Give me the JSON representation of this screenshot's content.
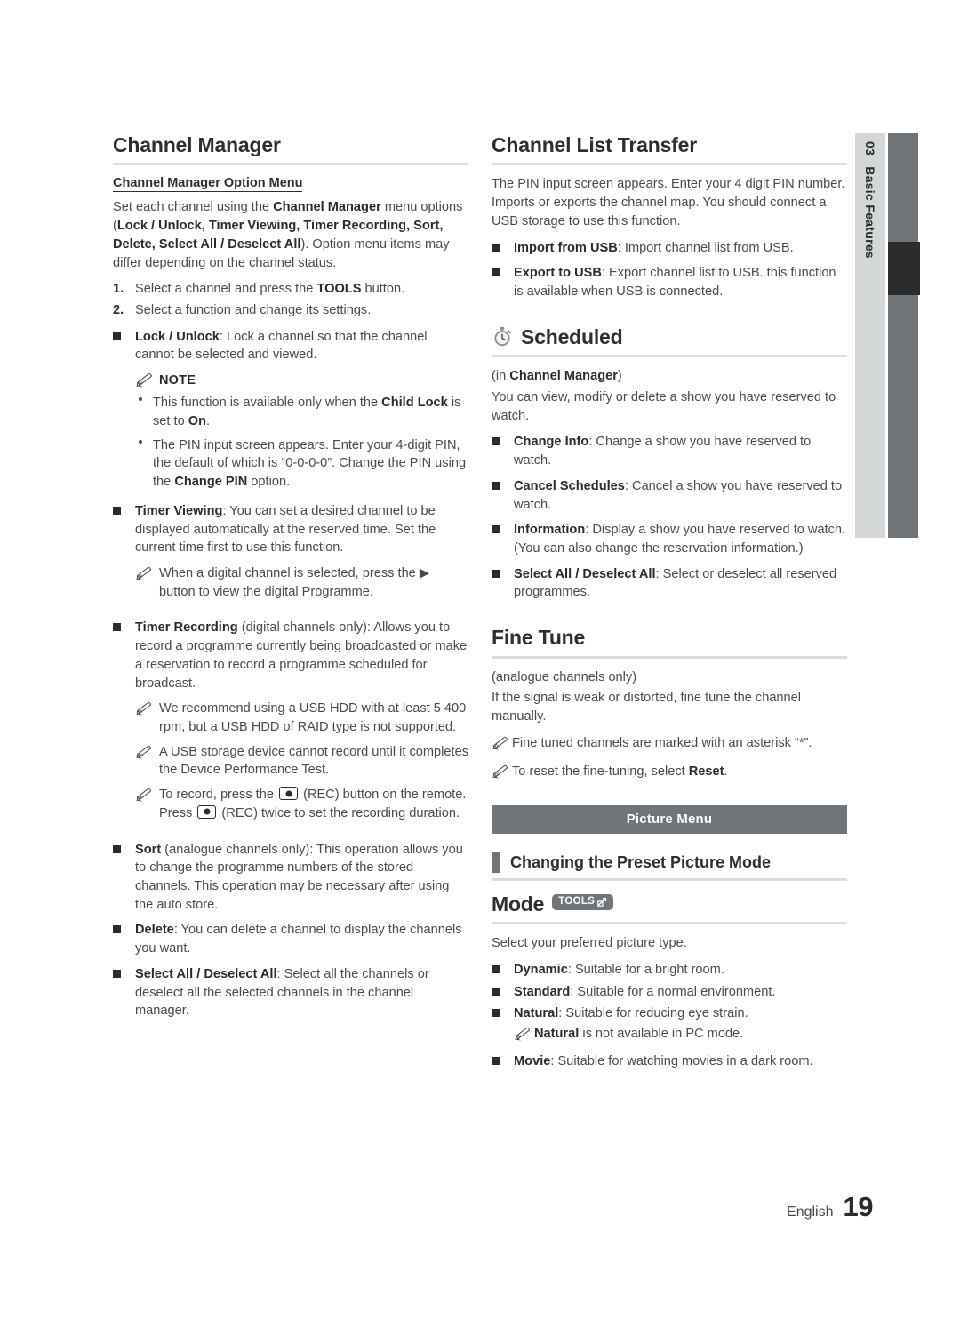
{
  "side_index": {
    "number": "03",
    "title": "Basic Features"
  },
  "footer": {
    "language": "English",
    "page_number": "19"
  },
  "left_column": {
    "heading": "Channel Manager",
    "subheading": "Channel Manager Option Menu",
    "intro_1": "Set each channel using the ",
    "intro_bold_1": "Channel Manager",
    "intro_2": " menu options (",
    "intro_bold_2": "Lock / Unlock, Timer Viewing, Timer Recording, Sort, Delete, Select All / Deselect All",
    "intro_3": "). Option menu items may differ depending on the channel status.",
    "steps": [
      {
        "marker": "1.",
        "text_a": "Select a channel and press the ",
        "bold": "TOOLS",
        "text_b": " button."
      },
      {
        "marker": "2.",
        "text_a": "Select a function and change its settings.",
        "bold": "",
        "text_b": ""
      }
    ],
    "lock_unlock": {
      "term": "Lock / Unlock",
      "desc": ": Lock a channel so that the channel cannot be selected and viewed."
    },
    "note_label": "NOTE",
    "notes": [
      {
        "a": "This function is available only when the ",
        "b1": "Child Lock",
        "c": " is set to ",
        "b2": "On",
        "d": "."
      },
      {
        "a": "The PIN input screen appears. Enter your 4-digit PIN, the default of which is “0-0-0-0”. Change the PIN using the ",
        "b1": "Change PIN",
        "c": " option.",
        "b2": "",
        "d": ""
      }
    ],
    "timer_viewing": {
      "term": "Timer Viewing",
      "desc": ": You can set a desired channel to be displayed automatically at the reserved time. Set the current time first to use this function.",
      "note_a": "When a digital channel is selected, press the ",
      "note_arrow": "▶",
      "note_b": " button to view the digital Programme."
    },
    "timer_recording": {
      "term": "Timer Recording",
      "desc": " (digital channels only): Allows you to record a programme currently being broadcasted or make a reservation to record a programme scheduled for broadcast.",
      "notes": [
        "We recommend using a USB HDD with at least 5 400 rpm, but a USB HDD of RAID type is not supported.",
        "A USB storage device cannot record until it completes the Device Performance Test."
      ],
      "rec_note_a": "To record, press the ",
      "rec_note_b": " (REC) button on the remote. Press ",
      "rec_note_c": " (REC) twice to set the recording duration."
    },
    "sort": {
      "term": "Sort",
      "desc": " (analogue channels only): This operation allows you to change the programme numbers of the stored channels. This operation may be necessary after using the auto store."
    },
    "delete": {
      "term": "Delete",
      "desc": ": You can delete a channel to display the channels you want."
    },
    "select_all": {
      "term": "Select All / Deselect All",
      "desc": ": Select all the channels or deselect all the selected channels in the channel manager."
    }
  },
  "right_column": {
    "channel_list_transfer": {
      "heading": "Channel List Transfer",
      "intro": "The PIN input screen appears. Enter your 4 digit PIN number. Imports or exports the channel map. You should connect a USB storage to use this function.",
      "items": [
        {
          "term": "Import from USB",
          "desc": ": Import channel list from USB."
        },
        {
          "term": "Export to USB",
          "desc": ": Export channel list to USB. this function is available when USB is connected."
        }
      ]
    },
    "scheduled": {
      "heading": "Scheduled",
      "icon": "stopwatch-icon",
      "context_a": "(in ",
      "context_bold": "Channel Manager",
      "context_b": ")",
      "intro": "You can view, modify or delete a show you have reserved to watch.",
      "items": [
        {
          "term": "Change Info",
          "desc": ": Change a show you have reserved to watch."
        },
        {
          "term": "Cancel Schedules",
          "desc": ": Cancel a show you have reserved to watch."
        },
        {
          "term": "Information",
          "desc": ": Display a show you have reserved to watch. (You can also change the reservation information.)"
        },
        {
          "term": "Select All / Deselect All",
          "desc": ": Select or deselect all reserved programmes."
        }
      ]
    },
    "fine_tune": {
      "heading": "Fine Tune",
      "context": "(analogue channels only)",
      "intro": "If the signal is weak or distorted, fine tune the channel manually.",
      "notes": [
        {
          "a": "Fine tuned channels are marked with an asterisk “*”.",
          "bold": "",
          "b": ""
        },
        {
          "a": "To reset the fine-tuning, select ",
          "bold": "Reset",
          "b": "."
        }
      ]
    },
    "picture_menu_banner": "Picture Menu",
    "section_heading": "Changing the Preset Picture Mode",
    "mode": {
      "heading": "Mode",
      "badge_label": "TOOLS",
      "badge_glyph": "⏎",
      "intro": "Select your preferred picture type.",
      "items": [
        {
          "term": "Dynamic",
          "desc": ": Suitable for a bright room."
        },
        {
          "term": "Standard",
          "desc": ": Suitable for a normal environment."
        },
        {
          "term": "Natural",
          "desc": ": Suitable for reducing eye strain."
        },
        {
          "term": "Movie",
          "desc": ": Suitable for watching movies in a dark room."
        }
      ],
      "natural_note_bold": "Natural",
      "natural_note_rest": " is not available in PC mode."
    }
  },
  "colors": {
    "accent_gray": "#70757a",
    "tab_light": "#d4d7d8",
    "tab_dark": "#2b2b2b",
    "rule": "#dcdcdc",
    "body_text": "#4a4a4a"
  }
}
